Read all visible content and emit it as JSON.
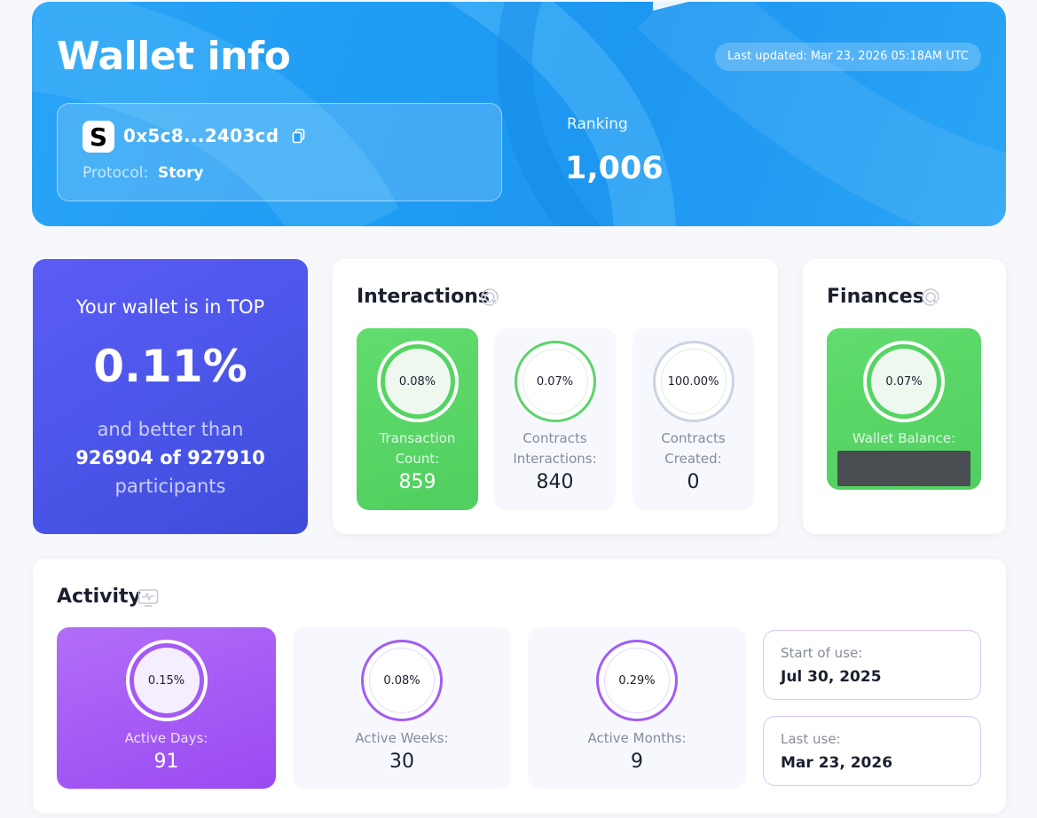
{
  "header": {
    "title": "Wallet info",
    "last_updated": "Last updated: Mar 23, 2026 05:18AM UTC",
    "address": "0x5c8...2403cd",
    "protocol_label": "Protocol:",
    "protocol_value": "Story",
    "ranking_label": "Ranking",
    "ranking_value": "1,006",
    "icons": {
      "logo": "story-logo-icon",
      "copy": "copy-icon"
    }
  },
  "top_card": {
    "line1": "Your wallet is in TOP",
    "percent": "0.11%",
    "line2": "and better than",
    "line3": "926904 of 927910",
    "line4": "participants"
  },
  "interactions": {
    "title": "Interactions",
    "tiles": [
      {
        "percent": "0.08%",
        "label_line1": "Transaction",
        "label_line2": "Count:",
        "value": "859"
      },
      {
        "percent": "0.07%",
        "label_line1": "Contracts",
        "label_line2": "Interactions:",
        "value": "840"
      },
      {
        "percent": "100.00%",
        "label_line1": "Contracts",
        "label_line2": "Created:",
        "value": "0"
      }
    ]
  },
  "finances": {
    "title": "Finances",
    "tile": {
      "percent": "0.07%",
      "label": "Wallet Balance:"
    }
  },
  "activity": {
    "title": "Activity",
    "tiles": [
      {
        "percent": "0.15%",
        "label": "Active Days:",
        "value": "91"
      },
      {
        "percent": "0.08%",
        "label": "Active Weeks:",
        "value": "30"
      },
      {
        "percent": "0.29%",
        "label": "Active Months:",
        "value": "9"
      }
    ],
    "start_label": "Start of use:",
    "start_value": "Jul 30, 2025",
    "last_label": "Last use:",
    "last_value": "Mar 23, 2026"
  },
  "colors": {
    "hero_blue": "#1f9cf3",
    "top_indigo": "#4a55e8",
    "green": "#56d463",
    "purple": "#9a49f2",
    "text_dark": "#1b1f2e",
    "text_muted": "#868b9c"
  }
}
